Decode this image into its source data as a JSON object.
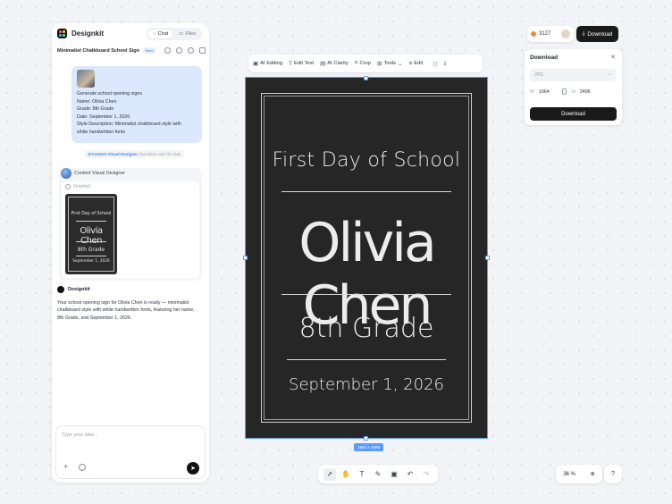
{
  "app": {
    "name": "Designkit",
    "tabs": [
      {
        "label": "Chat",
        "active": true
      },
      {
        "label": "Files",
        "active": false
      }
    ]
  },
  "project": {
    "title": "Minimalist Chalkboard School Sign",
    "badge": "Team"
  },
  "chat": {
    "user_prompt_lines": [
      "Generate school opening signs",
      "Name: Olivia Chen",
      "Grade: 8th Grade",
      "Date: September 1, 2026",
      "Style Description: Minimalist chalkboard style with",
      "white handwritten fonts"
    ],
    "takeover": {
      "agent": "@Content Visual Designer",
      "text": "has taken over the task"
    },
    "agent": {
      "name": "Content Visual Designer",
      "status": "Finished",
      "thumb": {
        "title": "First Day of School",
        "name": "Olivia Chen",
        "grade": "8th Grade",
        "date": "September 1, 2026"
      }
    },
    "reply": {
      "author": "Designkit",
      "text": "Your school opening sign for Olivia Chen is ready — minimalist chalkboard style with white handwritten fonts, featuring her name, 8th Grade, and September 1, 2026."
    },
    "composer": {
      "placeholder": "Type your idea..."
    }
  },
  "toolbar": {
    "items": [
      {
        "icon": "ai-editing-icon",
        "label": "AI Editing"
      },
      {
        "icon": "edit-text-icon",
        "label": "Edit Text"
      },
      {
        "icon": "ai-clarity-icon",
        "label": "AI Clarity"
      },
      {
        "icon": "crop-icon",
        "label": "Crop"
      },
      {
        "icon": "tools-icon",
        "label": "Tools"
      },
      {
        "icon": "edit-icon",
        "label": "Edit"
      }
    ]
  },
  "poster": {
    "title": "First Day of School",
    "name": "Olivia Chen",
    "grade": "8th Grade",
    "date": "September 1, 2026",
    "size_label": "1664 × 2496"
  },
  "header": {
    "credits": "3127",
    "download_label": "Download"
  },
  "download_panel": {
    "title": "Download",
    "format": "JPG",
    "width_label": "W",
    "width": "1664",
    "height_label": "H",
    "height": "2496",
    "button_label": "Download"
  },
  "bottom": {
    "zoom": "36",
    "zoom_unit": "%"
  },
  "colors": {
    "accent": "#5b9bff",
    "chalkboard": "#262626",
    "bubble": "#dbe8fd",
    "dark_button": "#1a1a1a"
  }
}
